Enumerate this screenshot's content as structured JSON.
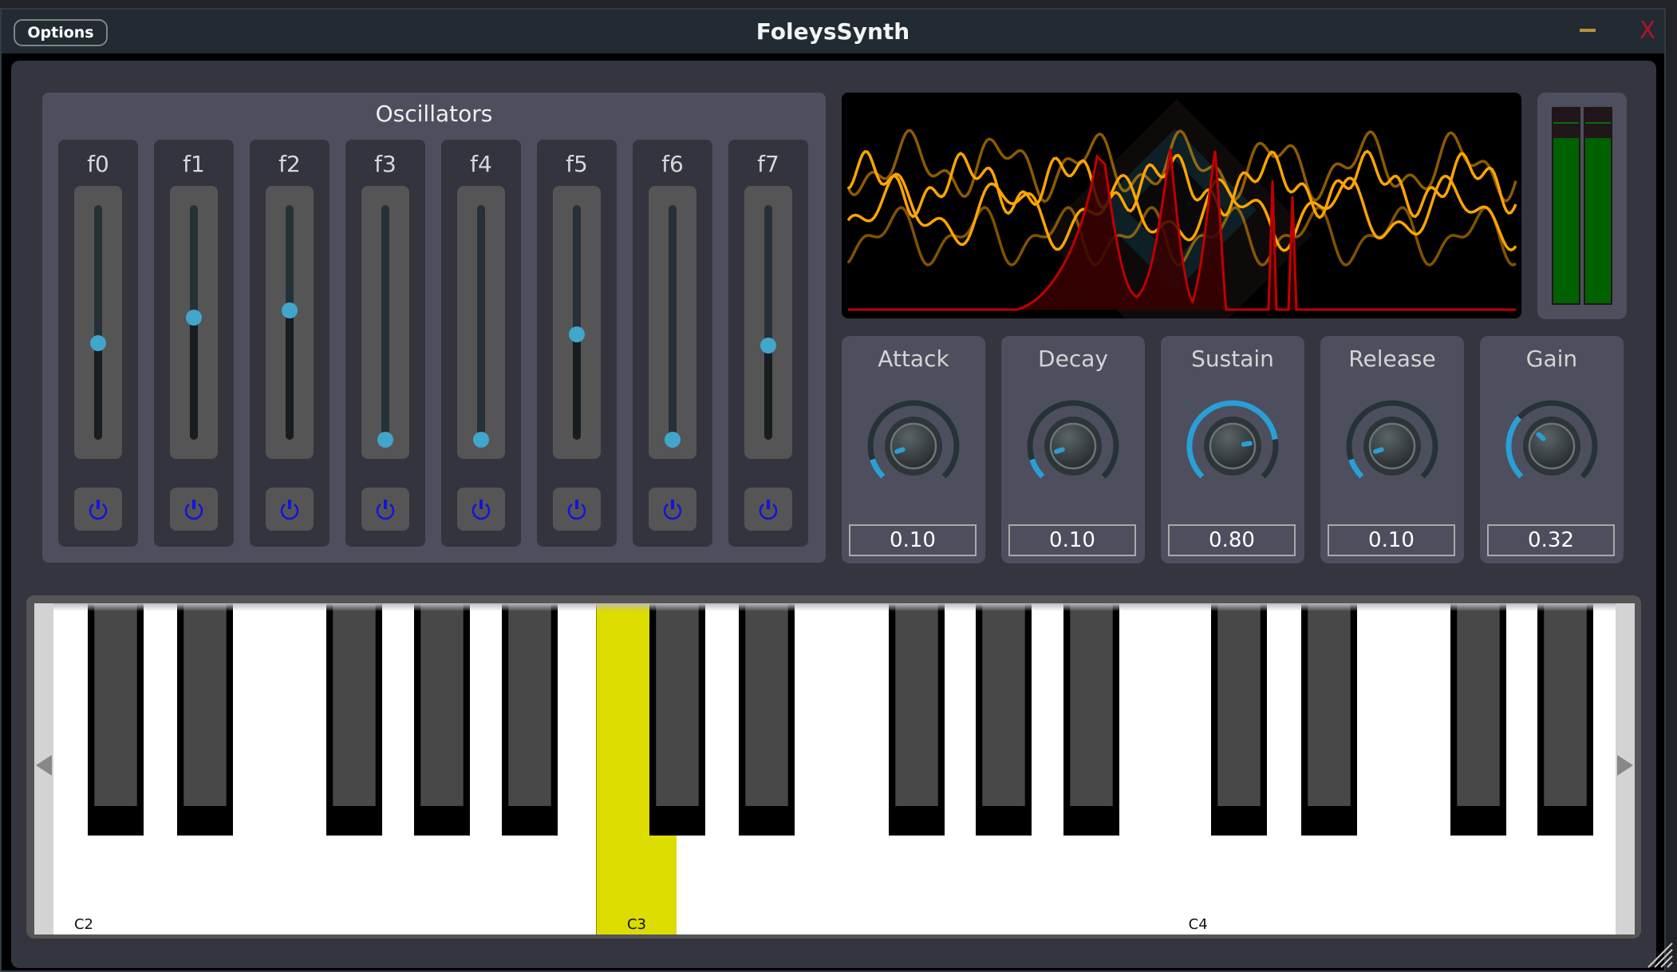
{
  "window": {
    "title": "FoleysSynth",
    "options_label": "Options",
    "minimize_icon": "minimize-icon",
    "close_icon": "close-icon",
    "close_glyph": "X"
  },
  "oscillators": {
    "title": "Oscillators",
    "items": [
      {
        "label": "f0",
        "value": 0.41,
        "enabled": true
      },
      {
        "label": "f1",
        "value": 0.52,
        "enabled": true
      },
      {
        "label": "f2",
        "value": 0.55,
        "enabled": true
      },
      {
        "label": "f3",
        "value": 0.0,
        "enabled": true
      },
      {
        "label": "f4",
        "value": 0.0,
        "enabled": true
      },
      {
        "label": "f5",
        "value": 0.45,
        "enabled": true
      },
      {
        "label": "f6",
        "value": 0.0,
        "enabled": true
      },
      {
        "label": "f7",
        "value": 0.4,
        "enabled": true
      }
    ],
    "power_icon": "power-icon"
  },
  "scope": {
    "name": "oscilloscope-spectrum",
    "wave_color": "#ffa500",
    "spectrum_color": "#c00000"
  },
  "meter": {
    "levels": [
      0.85,
      0.85
    ],
    "peaks": [
      0.93,
      0.93
    ],
    "color": "#006100"
  },
  "envelope": {
    "knobs": [
      {
        "label": "Attack",
        "value": 0.1,
        "display": "0.10"
      },
      {
        "label": "Decay",
        "value": 0.1,
        "display": "0.10"
      },
      {
        "label": "Sustain",
        "value": 0.8,
        "display": "0.80"
      },
      {
        "label": "Release",
        "value": 0.1,
        "display": "0.10"
      },
      {
        "label": "Gain",
        "value": 0.32,
        "display": "0.32"
      }
    ],
    "accent": "#2a9fd6"
  },
  "keyboard": {
    "start_note": "C2",
    "octave_labels": [
      "C2",
      "C3",
      "C4"
    ],
    "active_note": "C3",
    "active_color": "#dcdc00",
    "scroll_left_icon": "scroll-left-arrow-icon",
    "scroll_right_icon": "scroll-right-arrow-icon"
  }
}
